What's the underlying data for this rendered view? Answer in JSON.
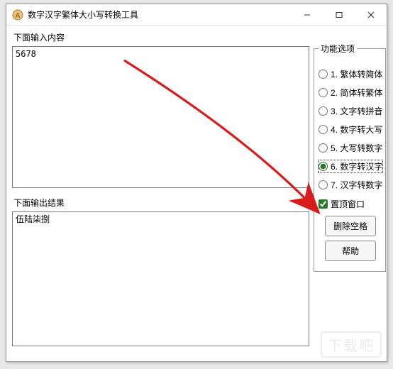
{
  "window": {
    "title": "数字汉字繁体大小写转换工具"
  },
  "labels": {
    "input": "下面输入内容",
    "output": "下面输出结果"
  },
  "fields": {
    "input_value": "5678",
    "output_value": "伍陆柒捌"
  },
  "options": {
    "legend": "功能选项",
    "items": [
      {
        "label": "1. 繁体转简体"
      },
      {
        "label": "2. 简体转繁体"
      },
      {
        "label": "3. 文字转拼音"
      },
      {
        "label": "4. 数字转大写"
      },
      {
        "label": "5. 大写转数字"
      },
      {
        "label": "6. 数字转汉字"
      },
      {
        "label": "7. 汉字转数字"
      }
    ],
    "selected_index": 5,
    "always_on_top": {
      "label": "置顶窗口",
      "checked": true
    }
  },
  "buttons": {
    "strip_spaces": "删除空格",
    "help": "帮助"
  },
  "watermark": "下载吧"
}
